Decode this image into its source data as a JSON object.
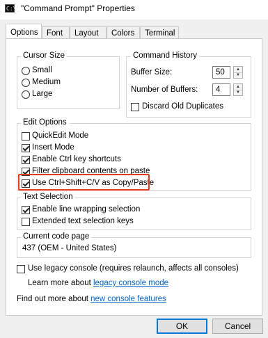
{
  "window": {
    "title": "\"Command Prompt\" Properties",
    "app_icon": "C:\\_"
  },
  "tabs": [
    {
      "label": "Options",
      "active": true
    },
    {
      "label": "Font",
      "active": false
    },
    {
      "label": "Layout",
      "active": false
    },
    {
      "label": "Colors",
      "active": false
    },
    {
      "label": "Terminal",
      "active": false
    }
  ],
  "cursor_size": {
    "title": "Cursor Size",
    "options": [
      "Small",
      "Medium",
      "Large"
    ]
  },
  "command_history": {
    "title": "Command History",
    "buffer_size_label": "Buffer Size:",
    "buffer_size_value": "50",
    "num_buffers_label": "Number of Buffers:",
    "num_buffers_value": "4",
    "discard_label": "Discard Old Duplicates",
    "discard_checked": false
  },
  "edit_options": {
    "title": "Edit Options",
    "items": [
      {
        "label": "QuickEdit Mode",
        "checked": false
      },
      {
        "label": "Insert Mode",
        "checked": true
      },
      {
        "label": "Enable Ctrl key shortcuts",
        "checked": true
      },
      {
        "label": "Filter clipboard contents on paste",
        "checked": true
      },
      {
        "label": "Use Ctrl+Shift+C/V as Copy/Paste",
        "checked": true
      }
    ],
    "highlight_color": "#e03c1f"
  },
  "text_selection": {
    "title": "Text Selection",
    "items": [
      {
        "label": "Enable line wrapping selection",
        "checked": true
      },
      {
        "label": "Extended text selection keys",
        "checked": false
      }
    ]
  },
  "code_page": {
    "title": "Current code page",
    "value": "437   (OEM - United States)"
  },
  "legacy": {
    "label": "Use legacy console (requires relaunch, affects all consoles)",
    "checked": false,
    "learn_prefix": "Learn more about ",
    "learn_link": "legacy console mode"
  },
  "find_out": {
    "prefix": "Find out more about ",
    "link": "new console features"
  },
  "buttons": {
    "ok": "OK",
    "cancel": "Cancel"
  }
}
